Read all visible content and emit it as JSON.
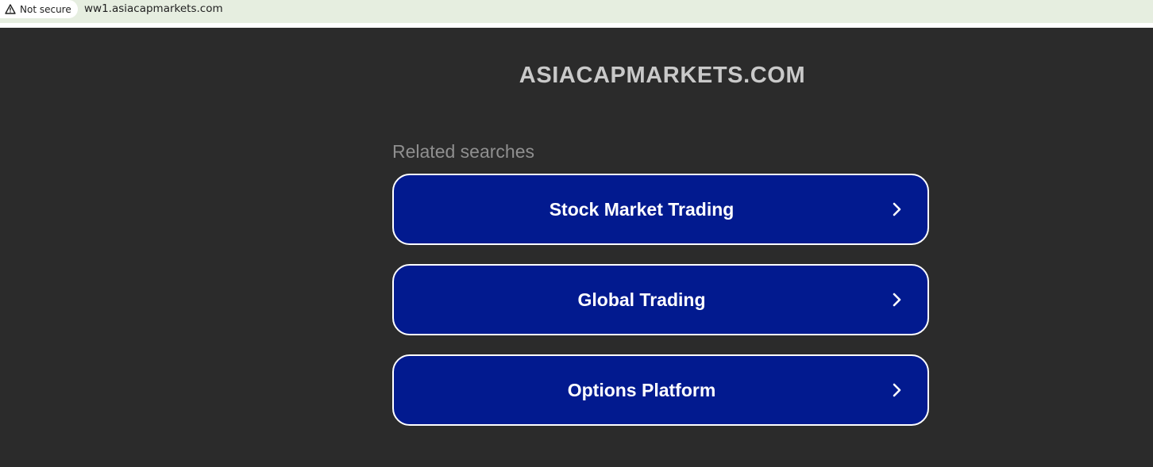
{
  "browser": {
    "security_label": "Not secure",
    "url": "ww1.asiacapmarkets.com",
    "security_icon": "warning-triangle-icon"
  },
  "page": {
    "domain_title": "ASIACAPMARKETS.COM",
    "related_label": "Related searches",
    "results": [
      {
        "label": "Stock Market Trading",
        "icon": "chevron-right-icon"
      },
      {
        "label": "Global Trading",
        "icon": "chevron-right-icon"
      },
      {
        "label": "Options Platform",
        "icon": "chevron-right-icon"
      }
    ]
  },
  "colors": {
    "background": "#2b2b2b",
    "button_fill": "#021a8f",
    "button_border": "#ffffff",
    "title_text": "#c9c9c9",
    "label_text": "#8f8f8f",
    "address_bar": "#e6eee0"
  }
}
